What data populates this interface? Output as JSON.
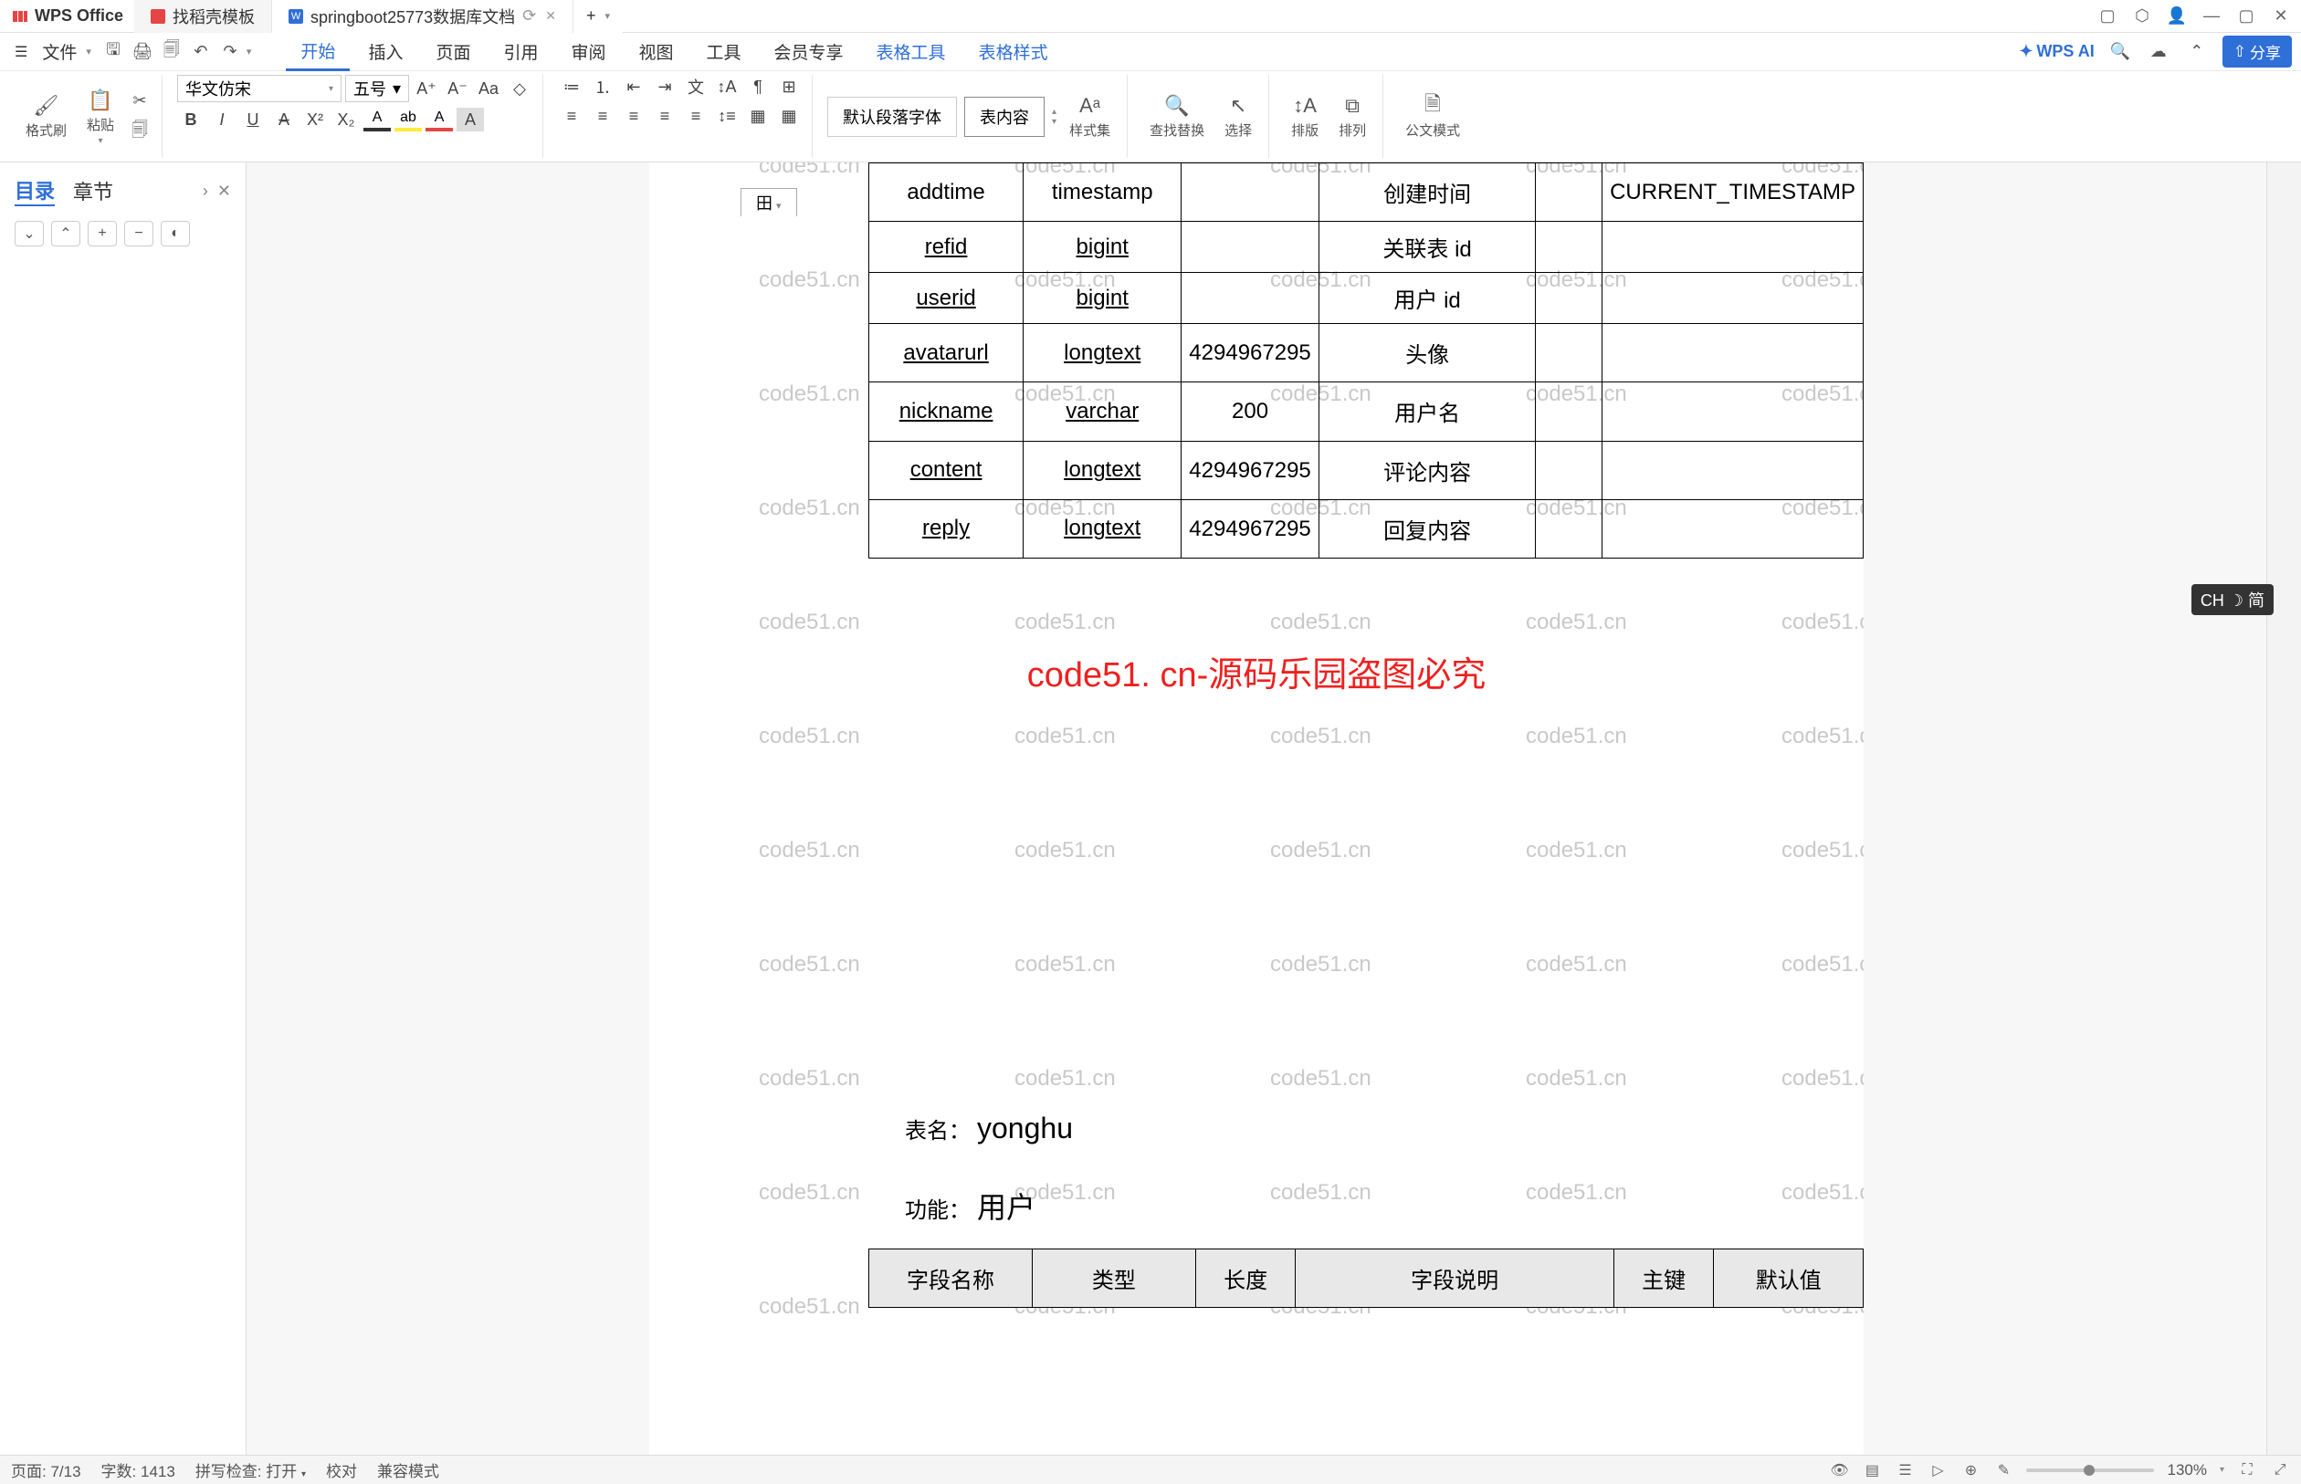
{
  "app": {
    "name": "WPS Office"
  },
  "tabs": [
    {
      "icon_color": "#e64545",
      "label": "找稻壳模板"
    },
    {
      "icon_color": "#2f6fd8",
      "label": "springboot25773数据库文档",
      "active": true,
      "closable": true
    }
  ],
  "newtab": "+",
  "menu": {
    "file": "文件",
    "items": [
      "开始",
      "插入",
      "页面",
      "引用",
      "审阅",
      "视图",
      "工具",
      "会员专享",
      "表格工具",
      "表格样式"
    ],
    "active": "开始",
    "wpsai": "WPS AI",
    "share": "分享"
  },
  "ribbon": {
    "format_painter": "格式刷",
    "paste": "粘贴",
    "font_name": "华文仿宋",
    "font_size": "五号",
    "style_default": "默认段落字体",
    "style_selected": "表内容",
    "style_set": "样式集",
    "find_replace": "查找替换",
    "select": "选择",
    "sort": "排版",
    "arrange": "排列",
    "official": "公文模式"
  },
  "sidebar": {
    "tab1": "目录",
    "tab2": "章节"
  },
  "watermark_text": "code51.cn",
  "red_watermark": "code51. cn-源码乐园盗图必究",
  "table_tab": "田",
  "table1": {
    "rows": [
      {
        "field": "addtime",
        "type": "timestamp",
        "len": "",
        "desc": "创建时间",
        "pk": "",
        "def": "CURRENT_TIMESTAMP"
      },
      {
        "field": "refid",
        "type": "bigint",
        "len": "",
        "desc": "关联表 id",
        "pk": "",
        "def": "",
        "u": true
      },
      {
        "field": "userid",
        "type": "bigint",
        "len": "",
        "desc": "用户 id",
        "pk": "",
        "def": "",
        "u": true
      },
      {
        "field": "avatarurl",
        "type": "longtext",
        "len": "4294967295",
        "desc": "头像",
        "pk": "",
        "def": "",
        "u": true
      },
      {
        "field": "nickname",
        "type": "varchar",
        "len": "200",
        "desc": "用户名",
        "pk": "",
        "def": "",
        "u": true
      },
      {
        "field": "content",
        "type": "longtext",
        "len": "4294967295",
        "desc": "评论内容",
        "pk": "",
        "def": "",
        "u": true
      },
      {
        "field": "reply",
        "type": "longtext",
        "len": "4294967295",
        "desc": "回复内容",
        "pk": "",
        "def": "",
        "u": true
      }
    ]
  },
  "section": {
    "tablename_label": "表名：",
    "tablename_value": "yonghu",
    "func_label": "功能：",
    "func_value": "用户"
  },
  "table2_headers": [
    "字段名称",
    "类型",
    "长度",
    "字段说明",
    "主键",
    "默认值"
  ],
  "status": {
    "page": "页面: 7/13",
    "words": "字数: 1413",
    "spell": "拼写检查: 打开",
    "proof": "校对",
    "compat": "兼容模式",
    "zoom": "130%"
  },
  "ime": "CH ☽ 简"
}
